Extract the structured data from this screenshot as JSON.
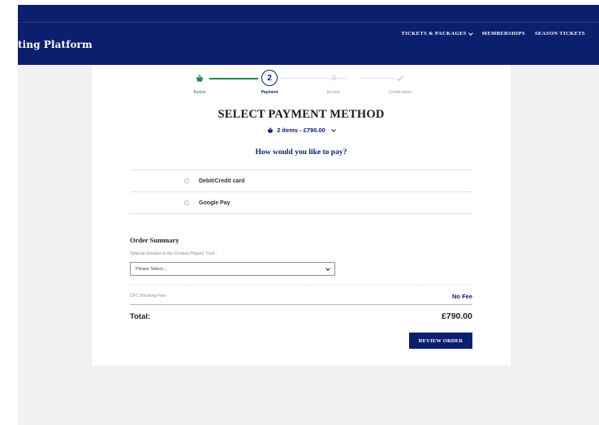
{
  "header": {
    "brand": "ting Platform",
    "nav": [
      {
        "label": "TICKETS & PACKAGES",
        "has_dropdown": true
      },
      {
        "label": "MEMBERSHIPS",
        "has_dropdown": false
      },
      {
        "label": "SEASON TICKETS",
        "has_dropdown": false
      }
    ]
  },
  "stepper": {
    "steps": [
      {
        "label": "Basket",
        "state": "done",
        "icon": "basket-icon"
      },
      {
        "label": "Payment",
        "state": "active",
        "number": "2"
      },
      {
        "label": "Review",
        "state": "todo",
        "number": "3"
      },
      {
        "label": "Confirmation",
        "state": "todo",
        "icon": "check-icon"
      }
    ]
  },
  "title": "SELECT PAYMENT METHOD",
  "basket_summary": {
    "text": "2 items - £790.00",
    "icon": "basket-icon"
  },
  "question": "How would you like to pay?",
  "payment_options": [
    {
      "label": "Debit/Credit card",
      "selected": false
    },
    {
      "label": "Google Pay",
      "selected": false
    }
  ],
  "order_summary": {
    "title": "Order Summary",
    "donation_label": "Optional donation to the Chelsea Players' Trust :",
    "donation_select": "Please Select...",
    "fee_label": "CFC Booking Fee:",
    "fee_value": "No Fee",
    "total_label": "Total:",
    "total_value": "£790.00"
  },
  "review_button": "REVIEW ORDER",
  "colors": {
    "brand_navy": "#0b1f6e",
    "success_green": "#1e8a4d",
    "page_bg": "#f1f1f2"
  }
}
